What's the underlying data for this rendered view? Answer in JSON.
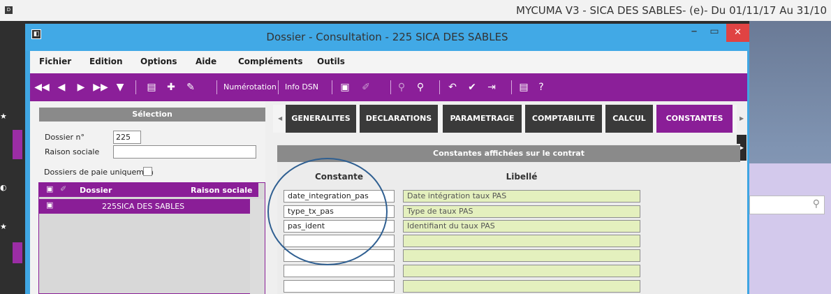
{
  "desktop": {
    "title": "MYCUMA V3 - SICA DES SABLES- (e)- Du 01/11/17 Au 31/10",
    "logo": "D",
    "search_icon": "search-icon"
  },
  "window": {
    "title": "Dossier - Consultation - 225 SICA DES SABLES",
    "minimize_glyph": "–",
    "maximize_glyph": "▭",
    "close_glyph": "✕",
    "icon_glyph": "◧"
  },
  "menu": [
    "Fichier",
    "Edition",
    "Options",
    "Aide",
    "Compléments",
    "Outils"
  ],
  "toolbar": {
    "icons": {
      "first": "first-record-icon",
      "previous": "previous-record-icon",
      "next": "next-record-icon",
      "last": "last-record-icon",
      "filter": "filter-icon",
      "document_add": "document-add-icon",
      "add": "plus-icon",
      "edit": "pencil-icon",
      "clipboard": "clipboard-icon",
      "attach": "attach-icon",
      "search": "search-icon",
      "search_plus": "search-plus-icon",
      "undo": "undo-icon",
      "validate": "check-icon",
      "exit": "exit-icon",
      "print": "print-icon",
      "help": "help-icon"
    },
    "numerotation_label": "Numérotation",
    "info_dsn_label": "Info DSN",
    "colors": {
      "toolbar_bg": "#8b1f99"
    }
  },
  "selection": {
    "header": "Sélection",
    "dossier_label": "Dossier n°",
    "dossier_value": "225",
    "raison_label": "Raison sociale",
    "raison_value": "",
    "paie_label": "Dossiers de paie uniquemen",
    "grid": {
      "headers": [
        "Dossier",
        "Raison sociale"
      ],
      "rows": [
        {
          "dossier": "225",
          "raison": "SICA DES SABLES"
        }
      ]
    }
  },
  "tabs": [
    {
      "label": "GENERALITES"
    },
    {
      "label": "DECLARATIONS"
    },
    {
      "label": "PARAMETRAGE"
    },
    {
      "label": "COMPTABILITE"
    },
    {
      "label": "CALCUL"
    },
    {
      "label": "CONSTANTES"
    }
  ],
  "constants": {
    "section_title": "Constantes affichées sur le contrat",
    "column_constante": "Constante",
    "column_libelle": "Libellé",
    "rows": [
      {
        "constante": "date_integration_pas",
        "libelle": "Date intégration taux PAS"
      },
      {
        "constante": "type_tx_pas",
        "libelle": "Type de taux PAS"
      },
      {
        "constante": "pas_ident",
        "libelle": "Identifiant du taux PAS"
      },
      {
        "constante": "",
        "libelle": ""
      },
      {
        "constante": "",
        "libelle": ""
      },
      {
        "constante": "",
        "libelle": ""
      },
      {
        "constante": "",
        "libelle": ""
      }
    ]
  }
}
